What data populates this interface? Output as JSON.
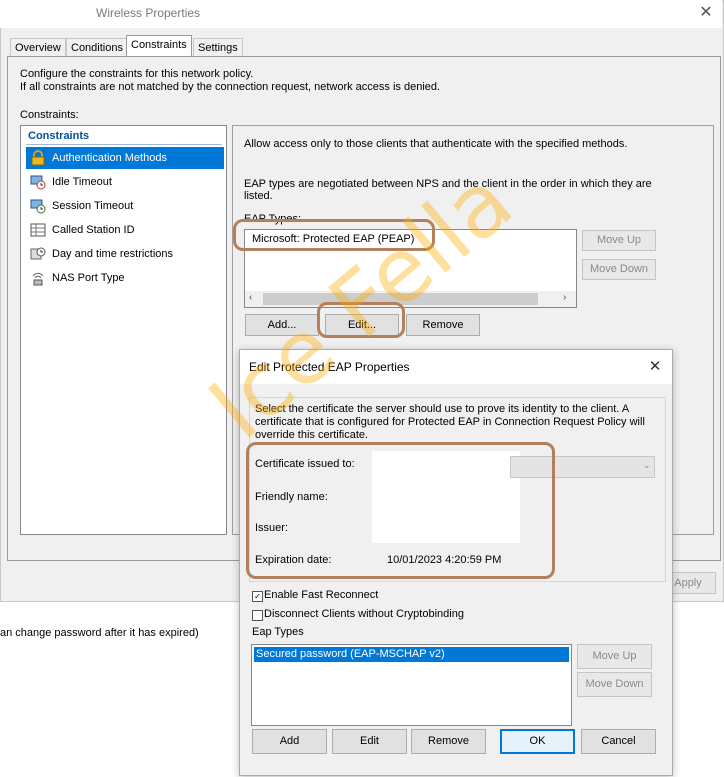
{
  "window": {
    "title": "Wireless Properties",
    "close": "✕",
    "tabs": [
      "Overview",
      "Conditions",
      "Constraints",
      "Settings"
    ],
    "description_line1": "Configure the constraints for this network policy.",
    "description_line2": "If all constraints are not matched by the connection request, network access is denied.",
    "constraints_label": "Constraints:",
    "list_header": "Constraints",
    "items": [
      {
        "label": "Authentication Methods",
        "icon": "lock-icon"
      },
      {
        "label": "Idle Timeout",
        "icon": "computer-clock-icon"
      },
      {
        "label": "Session Timeout",
        "icon": "computer-clock-icon"
      },
      {
        "label": "Called Station ID",
        "icon": "table-icon"
      },
      {
        "label": "Day and time restrictions",
        "icon": "clock-icon"
      },
      {
        "label": "NAS Port Type",
        "icon": "network-port-icon"
      }
    ],
    "right": {
      "allow_text": "Allow access only to those clients that authenticate with the specified methods.",
      "eap_note": "EAP types are negotiated between NPS and the client in the order in which they are listed.",
      "eap_types_label": "EAP Types:",
      "eap_item": "Microsoft: Protected EAP (PEAP)",
      "move_up": "Move Up",
      "move_down": "Move Down",
      "add": "Add...",
      "edit": "Edit...",
      "remove": "Remove"
    },
    "apply": "Apply"
  },
  "side_text": "an change password after it has expired)",
  "dialog": {
    "title": "Edit Protected EAP Properties",
    "close": "✕",
    "intro": "Select the certificate the server should use to prove its identity to the client. A certificate that is configured for Protected EAP in Connection Request Policy will override this certificate.",
    "issued_to_label": "Certificate issued to:",
    "friendly_label": "Friendly name:",
    "issuer_label": "Issuer:",
    "expiration_label": "Expiration date:",
    "expiration_value": "10/01/2023 4:20:59 PM",
    "fast_reconnect": "Enable Fast Reconnect",
    "disconnect": "Disconnect Clients without Cryptobinding",
    "eap_types_label": "Eap Types",
    "eap_item": "Secured password (EAP-MSCHAP v2)",
    "move_up": "Move Up",
    "move_down": "Move Down",
    "add": "Add",
    "edit": "Edit",
    "remove": "Remove",
    "ok": "OK",
    "cancel": "Cancel"
  },
  "watermark": "Ice Fella",
  "colors": {
    "selection": "#0078d7",
    "highlight_outline": "#b3805e",
    "watermark": "#ffaa00"
  }
}
